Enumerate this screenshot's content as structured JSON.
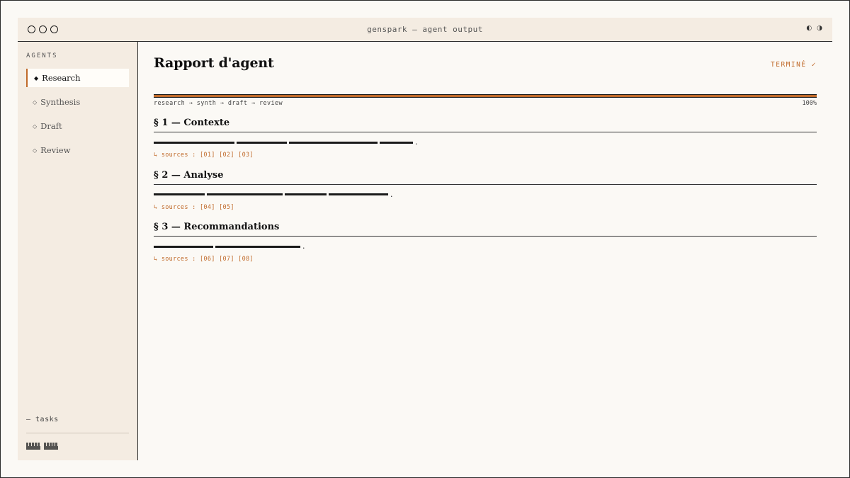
{
  "window": {
    "title": "genspark — agent output",
    "theme_toggle": "◐ ◑"
  },
  "sidebar": {
    "heading": "AGENTS",
    "items": [
      {
        "glyph": "◆",
        "label": "Research",
        "active": true
      },
      {
        "glyph": "◇",
        "label": "Synthesis",
        "active": false
      },
      {
        "glyph": "◇",
        "label": "Draft",
        "active": false
      },
      {
        "glyph": "◇",
        "label": "Review",
        "active": false
      }
    ],
    "tasks_link": "— tasks"
  },
  "main": {
    "title": "Rapport d'agent",
    "status": "TERMINÉ ✓",
    "progress_percent": 100,
    "progress_label": "100%",
    "pipeline": "research → synth → draft → review",
    "sections": [
      {
        "title": "§ 1 — Contexte",
        "sources": "↳ sources : [01] [02] [03]"
      },
      {
        "title": "§ 2 — Analyse",
        "sources": "↳ sources : [04] [05]"
      },
      {
        "title": "§ 3 — Recommandations",
        "sources": "↳ sources : [06] [07] [08]"
      }
    ]
  },
  "colors": {
    "accent": "#c06a2a",
    "sidebar_bg": "#f4ece2",
    "page_bg": "#fbf9f5",
    "ink": "#1a1a1a"
  }
}
